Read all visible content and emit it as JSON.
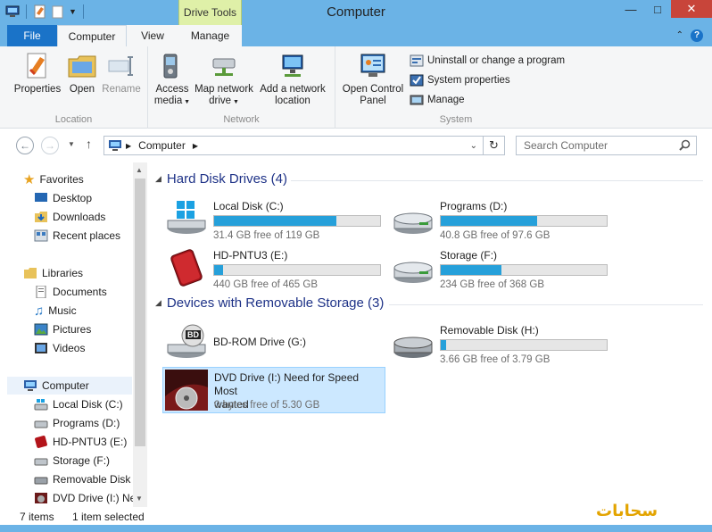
{
  "window": {
    "title": "Computer",
    "context_tab_group": "Drive Tools"
  },
  "tabs": [
    "File",
    "Computer",
    "View",
    "Manage"
  ],
  "ribbon": {
    "location": {
      "label": "Location",
      "properties": "Properties",
      "open": "Open",
      "rename": "Rename"
    },
    "network": {
      "label": "Network",
      "access_media_l1": "Access",
      "access_media_l2": "media",
      "map_drive_l1": "Map network",
      "map_drive_l2": "drive",
      "add_location_l1": "Add a network",
      "add_location_l2": "location"
    },
    "system": {
      "label": "System",
      "control_panel_l1": "Open Control",
      "control_panel_l2": "Panel",
      "uninstall": "Uninstall or change a program",
      "sys_props": "System properties",
      "manage": "Manage"
    }
  },
  "address": {
    "crumb": "Computer",
    "search_placeholder": "Search Computer"
  },
  "nav": {
    "favorites": {
      "label": "Favorites",
      "items": [
        "Desktop",
        "Downloads",
        "Recent places"
      ]
    },
    "libraries": {
      "label": "Libraries",
      "items": [
        "Documents",
        "Music",
        "Pictures",
        "Videos"
      ]
    },
    "computer": {
      "label": "Computer",
      "items": [
        "Local Disk (C:)",
        "Programs (D:)",
        "HD-PNTU3 (E:)",
        "Storage (F:)",
        "Removable Disk (",
        "DVD Drive (I:) Ne"
      ]
    }
  },
  "content": {
    "hdd_header": "Hard Disk Drives (4)",
    "removable_header": "Devices with Removable Storage (3)",
    "drives": [
      {
        "name": "Local Disk (C:)",
        "free": "31.4 GB free of 119 GB",
        "used_fraction": 0.736
      },
      {
        "name": "Programs (D:)",
        "free": "40.8 GB free of 97.6 GB",
        "used_fraction": 0.582
      },
      {
        "name": "HD-PNTU3 (E:)",
        "free": "440 GB free of 465 GB",
        "used_fraction": 0.054
      },
      {
        "name": "Storage (F:)",
        "free": "234 GB free of 368 GB",
        "used_fraction": 0.364
      }
    ],
    "removable": [
      {
        "name": "BD-ROM Drive (G:)",
        "badge": "BD"
      },
      {
        "name": "Removable Disk (H:)",
        "free": "3.66 GB free of 3.79 GB",
        "used_fraction": 0.034
      },
      {
        "name_l1": "DVD Drive (I:) Need for Speed Most",
        "name_l2": "wanted",
        "free": "0 bytes free of 5.30 GB"
      }
    ]
  },
  "status": {
    "items": "7 items",
    "selected": "1 item selected"
  },
  "watermark": "سحابات"
}
